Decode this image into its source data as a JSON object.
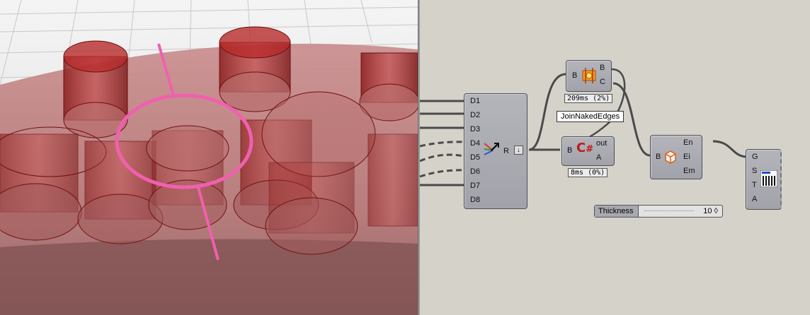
{
  "viewport": {
    "name": "Rhino viewport"
  },
  "canvas": {
    "merge": {
      "inputs": [
        "D1",
        "D2",
        "D3",
        "D4",
        "D5",
        "D6",
        "D7",
        "D8"
      ],
      "output": "R"
    },
    "brep_edges": {
      "input": "B",
      "outputs": [
        "B",
        "C"
      ],
      "timing": "209ms (2%)"
    },
    "script": {
      "input": "B",
      "outputs": [
        "out",
        "A"
      ],
      "timing": "8ms (0%)",
      "tooltip": "JoinNakedEdges"
    },
    "edges": {
      "input": "B",
      "outputs": [
        "En",
        "Ei",
        "Em"
      ]
    },
    "graph": {
      "inputs": [
        "G",
        "S",
        "T",
        "A"
      ]
    },
    "slider": {
      "label": "Thickness",
      "value": "10 ◊"
    },
    "icons": {
      "merge": "merge-arrow-icon",
      "brep": "brep-components-icon",
      "script": "csharp-script-icon",
      "edges": "box-edges-icon",
      "graph": "bar-graph-icon",
      "flatten": "flatten-arrow-icon"
    }
  }
}
